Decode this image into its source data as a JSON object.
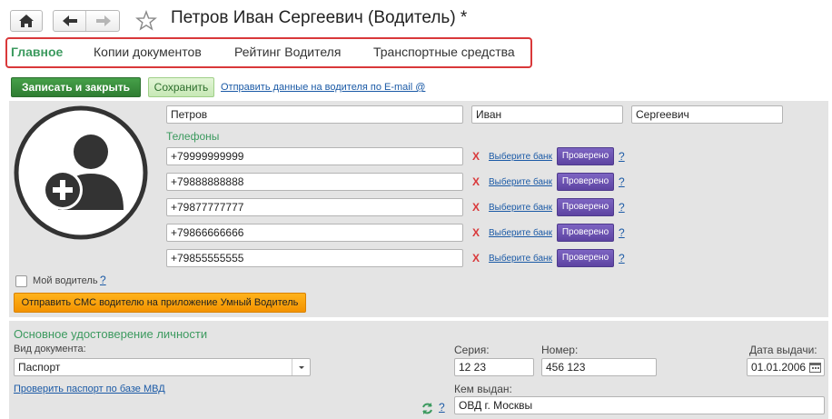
{
  "header": {
    "title": "Петров Иван Сергеевич (Водитель) *",
    "icons": [
      "home-icon",
      "back-arrow-icon",
      "forward-arrow-icon",
      "star-icon"
    ]
  },
  "tabs": [
    {
      "label": "Главное",
      "active": true
    },
    {
      "label": "Копии документов",
      "active": false
    },
    {
      "label": "Рейтинг Водителя",
      "active": false
    },
    {
      "label": "Транспортные средства",
      "active": false
    }
  ],
  "toolbar": {
    "save_close_label": "Записать и закрыть",
    "save_label": "Сохранить",
    "email_link": "Отправить данные на водителя по E-mail @"
  },
  "driver": {
    "last_name": "Петров",
    "first_name": "Иван",
    "middle_name": "Сергеевич",
    "phones_label": "Телефоны",
    "phones": [
      "+79999999999",
      "+79888888888",
      "+79877777777",
      "+79866666666",
      "+79855555555"
    ],
    "phone_status_mark": "X",
    "bank_link": "Выберите банк",
    "verified_label": "Проверено",
    "help_mark": "?",
    "my_driver_label": "Мой водитель",
    "my_driver_checked": false,
    "sms_button": "Отправить СМС водителю на приложение Умный Водитель"
  },
  "identity": {
    "section_title": "Основное удостоверение личности",
    "doc_type_label": "Вид документа:",
    "doc_type_value": "Паспорт",
    "series_label": "Серия:",
    "series_value": "12 23",
    "number_label": "Номер:",
    "number_value": "456 123",
    "issue_date_label": "Дата выдачи:",
    "issue_date_value": "01.01.2006",
    "check_link": "Проверить паспорт по базе МВД",
    "issued_by_label": "Кем выдан:",
    "issued_by_value": "ОВД г. Москвы",
    "help_mark": "?"
  },
  "colors": {
    "accent_green": "#3c9a5f",
    "tab_highlight": "#d9383a",
    "verified_purple": "#6a50b0",
    "sms_orange": "#f8a10e"
  }
}
